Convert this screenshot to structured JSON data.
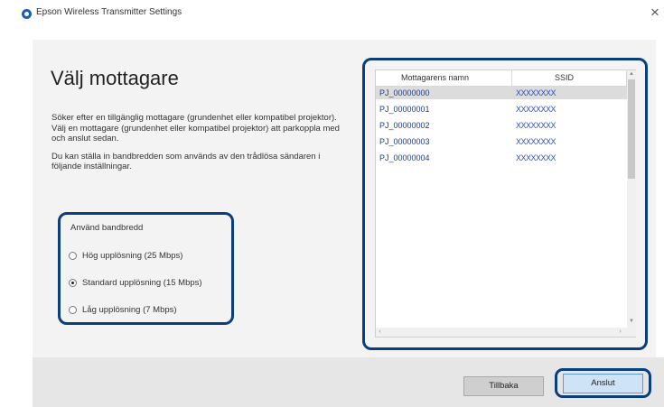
{
  "window": {
    "title": "Epson Wireless Transmitter Settings",
    "close_glyph": "×"
  },
  "page": {
    "heading": "Välj mottagare",
    "description": [
      "Söker efter en tillgänglig mottagare (grundenhet eller kompatibel projektor).\nVälj en mottagare (grundenhet eller kompatibel projektor) att parkoppla med och anslut sedan.",
      "Du kan ställa in bandbredden som används av den trådlösa sändaren i följande inställningar."
    ]
  },
  "bandwidth": {
    "title": "Använd bandbredd",
    "options": [
      {
        "label": "Hög upplösning (25 Mbps)",
        "selected": false
      },
      {
        "label": "Standard upplösning (15 Mbps)",
        "selected": true
      },
      {
        "label": "Låg upplösning (7 Mbps)",
        "selected": false
      }
    ]
  },
  "receivers": {
    "columns": [
      "Mottagarens namn",
      "SSID"
    ],
    "rows": [
      {
        "name": "PJ_00000000",
        "ssid": "XXXXXXXX",
        "selected": true
      },
      {
        "name": "PJ_00000001",
        "ssid": "XXXXXXXX",
        "selected": false
      },
      {
        "name": "PJ_00000002",
        "ssid": "XXXXXXXX",
        "selected": false
      },
      {
        "name": "PJ_00000003",
        "ssid": "XXXXXXXX",
        "selected": false
      },
      {
        "name": "PJ_00000004",
        "ssid": "XXXXXXXX",
        "selected": false
      }
    ],
    "scroll_glyphs": {
      "up": "▲",
      "down": "▼",
      "left": "‹",
      "right": "›"
    }
  },
  "buttons": {
    "back": "Tillbaka",
    "connect": "Anslut"
  },
  "colors": {
    "highlight_frame": "#0b3f7c",
    "link_text": "#1f3c88",
    "primary_button": "#cfe3f6"
  },
  "icons": {
    "app": "epson-app-icon",
    "close": "close-icon"
  }
}
